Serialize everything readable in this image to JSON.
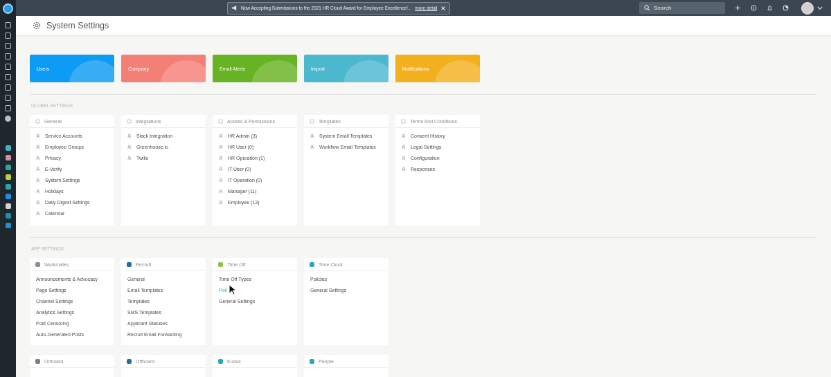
{
  "topbar": {
    "announcement": "Now Accepting Submissions to the 2021 HR Cloud Award for Employee Excellence!...",
    "announcement_link": "more detail",
    "search": {
      "placeholder": "Search"
    }
  },
  "page": {
    "title": "System Settings"
  },
  "tiles": [
    {
      "label": "Users",
      "color": "#0d9cf5"
    },
    {
      "label": "Company",
      "color": "#f47f76"
    },
    {
      "label": "Email Alerts",
      "color": "#67b323"
    },
    {
      "label": "Import",
      "color": "#4bb8cf"
    },
    {
      "label": "Notifications",
      "color": "#f2b01f"
    }
  ],
  "sections": [
    {
      "title": "GLOBAL SETTINGS",
      "kind": "global",
      "cards": [
        {
          "title": "General",
          "items": [
            {
              "label": "Service Accounts"
            },
            {
              "label": "Employee Groups"
            },
            {
              "label": "Privacy"
            },
            {
              "label": "E-Verify"
            },
            {
              "label": "System Settings"
            },
            {
              "label": "Holidays"
            },
            {
              "label": "Daily Digest Settings"
            },
            {
              "label": "Calendar"
            }
          ]
        },
        {
          "title": "Integrations",
          "items": [
            {
              "label": "Slack Integration"
            },
            {
              "label": "Greenhouse.io"
            },
            {
              "label": "Twilio"
            }
          ]
        },
        {
          "title": "Access & Permissions",
          "items": [
            {
              "label": "HR Admin (3)"
            },
            {
              "label": "HR User (0)"
            },
            {
              "label": "HR Operation (1)"
            },
            {
              "label": "IT User (0)"
            },
            {
              "label": "IT Operation (0)"
            },
            {
              "label": "Manager (11)"
            },
            {
              "label": "Employee (13)"
            }
          ]
        },
        {
          "title": "Templates",
          "items": [
            {
              "label": "System Email Templates"
            },
            {
              "label": "Workflow Email Templates"
            }
          ]
        },
        {
          "title": "Terms And Conditions",
          "items": [
            {
              "label": "Consent History"
            },
            {
              "label": "Legal Settings"
            },
            {
              "label": "Configuration"
            },
            {
              "label": "Responses"
            }
          ]
        }
      ]
    },
    {
      "title": "APP SETTINGS",
      "kind": "app",
      "cards": [
        {
          "title": "Workmates",
          "color": "#8a9196",
          "items": [
            {
              "label": "Announcements & Advocacy",
              "hovered": false
            },
            {
              "label": "Page Settings",
              "hovered": false
            },
            {
              "label": "Channel Settings",
              "hovered": false
            },
            {
              "label": "Analytics Settings",
              "hovered": false
            },
            {
              "label": "Post Censoring",
              "hovered": false
            },
            {
              "label": "Auto-Generated Posts",
              "hovered": false
            }
          ]
        },
        {
          "title": "Recruit",
          "color": "#1f6fa8",
          "items": [
            {
              "label": "General",
              "hovered": false
            },
            {
              "label": "Email Templates",
              "hovered": false
            },
            {
              "label": "Templates",
              "hovered": false
            },
            {
              "label": "SMS Templates",
              "hovered": false
            },
            {
              "label": "Applicant Statuses",
              "hovered": false
            },
            {
              "label": "Recruit Email Forwarding",
              "hovered": false
            }
          ]
        },
        {
          "title": "Time Off",
          "color": "#8cc63f",
          "items": [
            {
              "label": "Time Off Types",
              "hovered": false
            },
            {
              "label": "Poli",
              "hovered": true
            },
            {
              "label": "General Settings",
              "hovered": false
            }
          ]
        },
        {
          "title": "Time Clock",
          "color": "#2aa8b8",
          "items": [
            {
              "label": "Policies",
              "hovered": false
            },
            {
              "label": "General Settings",
              "hovered": false
            }
          ]
        }
      ]
    },
    {
      "kind": "app-cut",
      "cards": [
        {
          "title": "Onboard",
          "color": "#7a7f84"
        },
        {
          "title": "Offboard",
          "color": "#1f6fa8"
        },
        {
          "title": "Kudos",
          "color": "#2aa8b8"
        },
        {
          "title": "People",
          "color": "#2aa8b8"
        }
      ]
    }
  ]
}
